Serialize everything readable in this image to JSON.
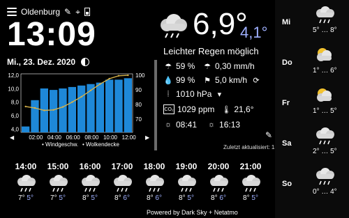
{
  "location": "Oldenburg",
  "time": "13:09",
  "date": "Mi., 23. Dez. 2020",
  "current": {
    "temp": "6,9°",
    "feels": "4,1°",
    "condition": "Leichter Regen möglich",
    "rain_prob": "59 %",
    "rain_rate": "0,30 mm/h",
    "humidity": "99 %",
    "wind": "5,0 km/h",
    "pressure": "1010 hPa",
    "co2": "1029 ppm",
    "inside_temp": "21,6°",
    "sunrise": "08:41",
    "sunset": "16:13",
    "updated": "Zuletzt aktualisiert: 13:07",
    "co2_label": "CO₂"
  },
  "chart_data": {
    "type": "bar",
    "categories": [
      "02:00",
      "04:00",
      "06:00",
      "08:00",
      "10:00",
      "12:00"
    ],
    "x_ticks_left": [
      "02:00",
      "04:00",
      "06:00",
      "08:00",
      "10:00",
      "12:00"
    ],
    "ylim_left": [
      0,
      12.0
    ],
    "left_ticks": [
      "12,0",
      "10,0",
      "8,0",
      "6,0",
      "4,0"
    ],
    "ylim_right": [
      60,
      100
    ],
    "right_ticks": [
      "100",
      "90",
      "80",
      "70"
    ],
    "series": [
      {
        "name": "Wolkendecke",
        "values": [
          64,
          82,
          90,
          89,
          90,
          91,
          92,
          93,
          94,
          96,
          96,
          97
        ]
      },
      {
        "name": "Windgeschw.",
        "values": [
          5.3,
          5.0,
          4.5,
          4.6,
          5.2,
          6.2,
          7.3,
          8.6,
          9.9,
          11.0,
          11.6,
          11.7
        ]
      }
    ],
    "legend": [
      "Windgeschw.",
      "Wolkendecke"
    ]
  },
  "daily": [
    {
      "day": "Mi",
      "min": "5°",
      "max": "8°"
    },
    {
      "day": "Do",
      "min": "1°",
      "max": "6°"
    },
    {
      "day": "Fr",
      "min": "1°",
      "max": "5°"
    },
    {
      "day": "Sa",
      "min": "2°",
      "max": "5°"
    },
    {
      "day": "So",
      "min": "0°",
      "max": "4°"
    }
  ],
  "hourly": [
    {
      "time": "14:00",
      "temp": "7°",
      "feels": "5°"
    },
    {
      "time": "15:00",
      "temp": "7°",
      "feels": "5°"
    },
    {
      "time": "16:00",
      "temp": "8°",
      "feels": "5°"
    },
    {
      "time": "17:00",
      "temp": "8°",
      "feels": "6°"
    },
    {
      "time": "18:00",
      "temp": "8°",
      "feels": "6°"
    },
    {
      "time": "19:00",
      "temp": "8°",
      "feels": "5°"
    },
    {
      "time": "20:00",
      "temp": "8°",
      "feels": "6°"
    },
    {
      "time": "21:00",
      "temp": "8°",
      "feels": "5°"
    }
  ],
  "footer": "Powered by Dark Sky + Netatmo"
}
